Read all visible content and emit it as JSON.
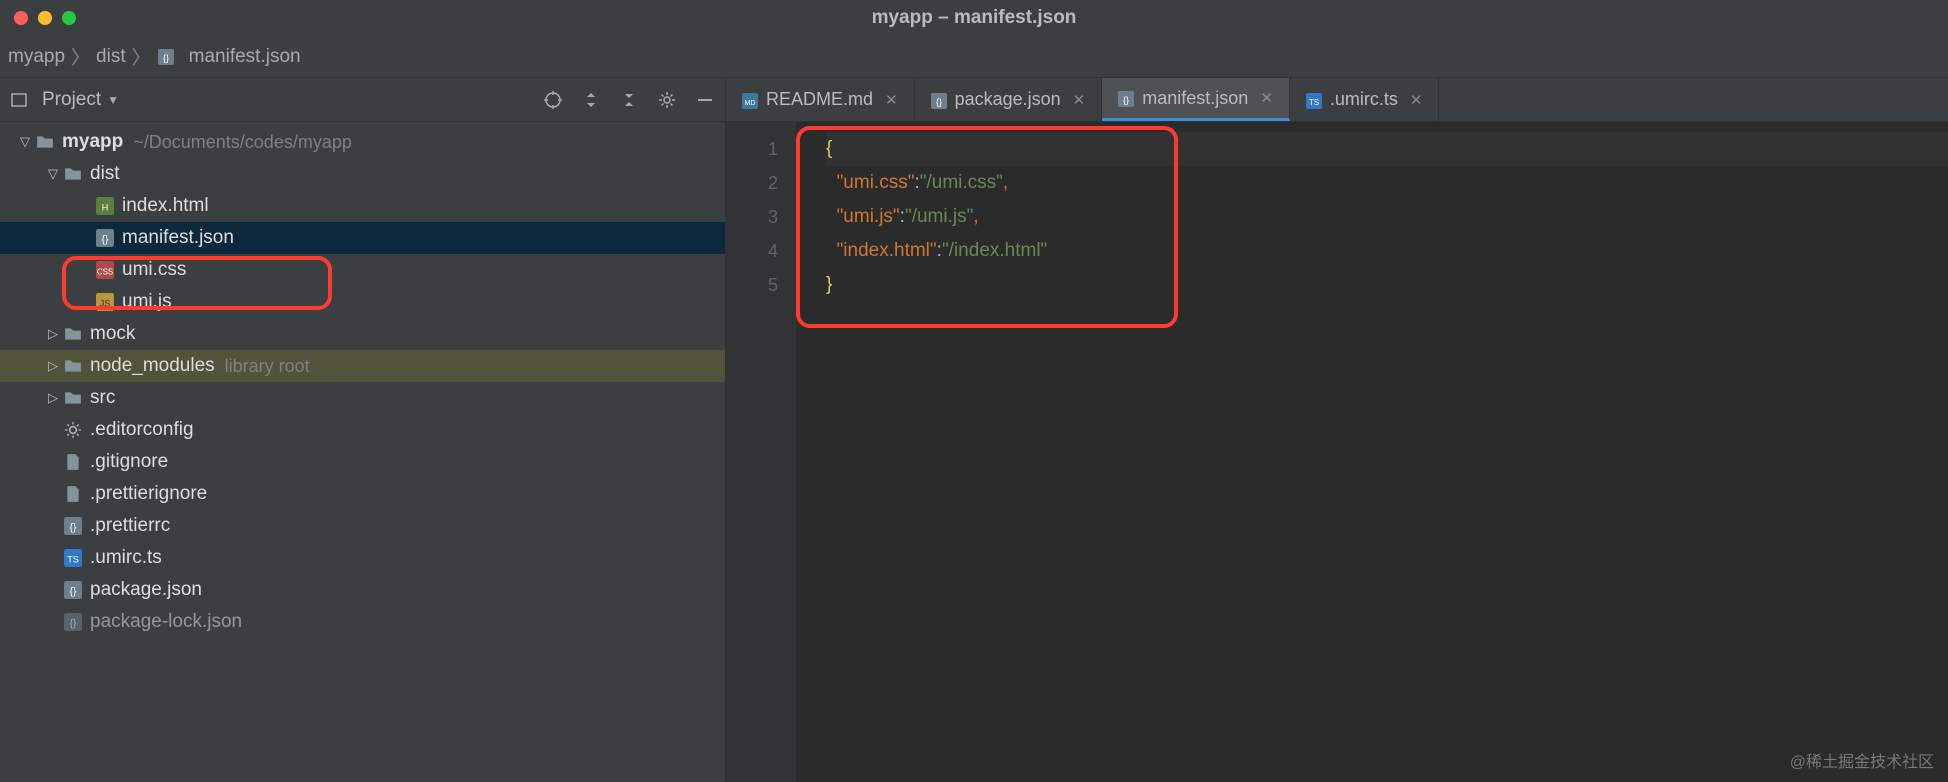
{
  "window": {
    "title": "myapp – manifest.json"
  },
  "breadcrumb": {
    "items": [
      "myapp",
      "dist",
      "manifest.json"
    ]
  },
  "sidebar": {
    "title": "Project",
    "tree": [
      {
        "id": "root",
        "label": "myapp",
        "hint": "~/Documents/codes/myapp",
        "indent": 0,
        "icon": "folder",
        "expand": "down",
        "bold": true
      },
      {
        "id": "dist",
        "label": "dist",
        "indent": 1,
        "icon": "folder",
        "expand": "down"
      },
      {
        "id": "indexhtml",
        "label": "index.html",
        "indent": 2,
        "icon": "html"
      },
      {
        "id": "manifest",
        "label": "manifest.json",
        "indent": 2,
        "icon": "json",
        "selected": true
      },
      {
        "id": "umicss",
        "label": "umi.css",
        "indent": 2,
        "icon": "css"
      },
      {
        "id": "umijs",
        "label": "umi.js",
        "indent": 2,
        "icon": "js"
      },
      {
        "id": "mock",
        "label": "mock",
        "indent": 1,
        "icon": "folder",
        "expand": "right"
      },
      {
        "id": "nodemod",
        "label": "node_modules",
        "hint": "library root",
        "indent": 1,
        "icon": "folder",
        "expand": "right",
        "library": true
      },
      {
        "id": "src",
        "label": "src",
        "indent": 1,
        "icon": "folder",
        "expand": "right"
      },
      {
        "id": "editorcfg",
        "label": ".editorconfig",
        "indent": 1,
        "icon": "gear"
      },
      {
        "id": "gitignore",
        "label": ".gitignore",
        "indent": 1,
        "icon": "file"
      },
      {
        "id": "prettignore",
        "label": ".prettierignore",
        "indent": 1,
        "icon": "file"
      },
      {
        "id": "prettierrc",
        "label": ".prettierrc",
        "indent": 1,
        "icon": "json"
      },
      {
        "id": "umirc",
        "label": ".umirc.ts",
        "indent": 1,
        "icon": "ts"
      },
      {
        "id": "pkg",
        "label": "package.json",
        "indent": 1,
        "icon": "json"
      },
      {
        "id": "pkglock",
        "label": "package-lock.json",
        "indent": 1,
        "icon": "json",
        "cut": true
      }
    ]
  },
  "tabs": [
    {
      "label": "README.md",
      "icon": "md"
    },
    {
      "label": "package.json",
      "icon": "json"
    },
    {
      "label": "manifest.json",
      "icon": "json",
      "active": true
    },
    {
      "label": ".umirc.ts",
      "icon": "ts"
    }
  ],
  "code": {
    "lines": [
      {
        "n": "1",
        "type": "brace-open"
      },
      {
        "n": "2",
        "key": "umi.css",
        "val": "/umi.css",
        "comma": true
      },
      {
        "n": "3",
        "key": "umi.js",
        "val": "/umi.js",
        "comma": true
      },
      {
        "n": "4",
        "key": "index.html",
        "val": "/index.html"
      },
      {
        "n": "5",
        "type": "brace-close"
      }
    ]
  },
  "watermark": "@稀土掘金技术社区"
}
